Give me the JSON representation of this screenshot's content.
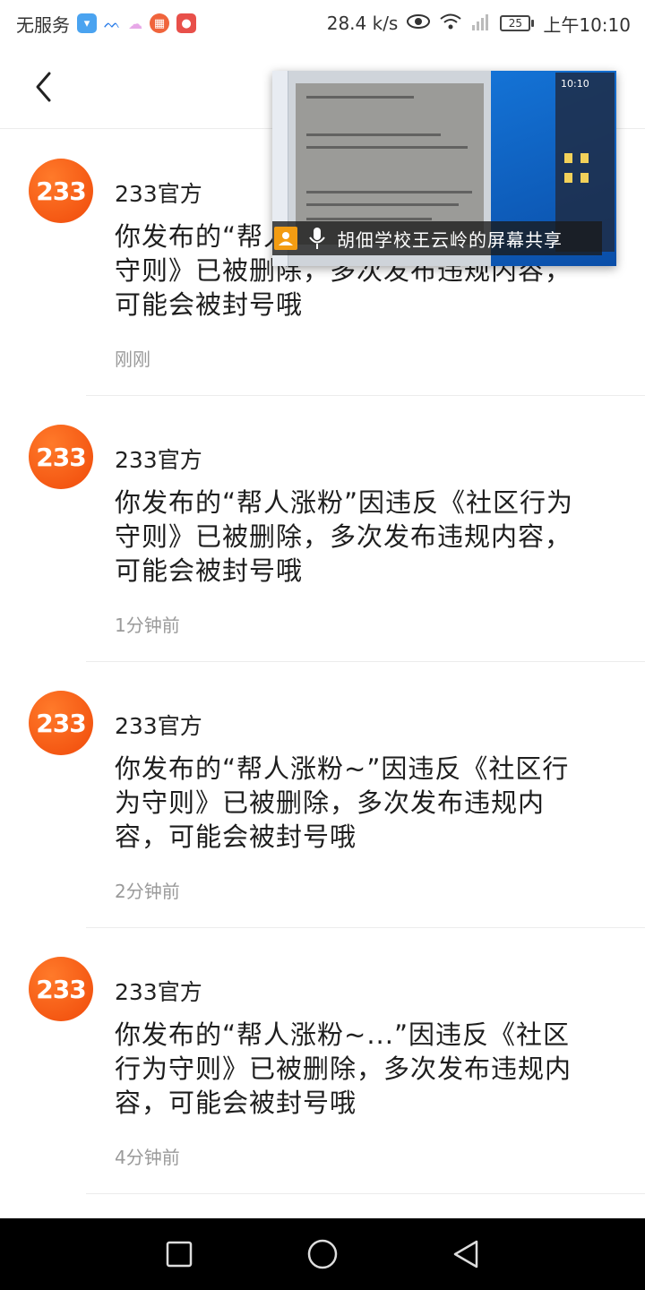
{
  "status_bar": {
    "carrier": "无服务",
    "net_speed": "28.4 k/s",
    "battery": "25",
    "time": "上午10:10",
    "icons": [
      "shield-app-icon",
      "bird-app-icon",
      "cloud-app-icon",
      "grid-app-icon",
      "mic-app-icon",
      "eye-icon",
      "wifi-icon",
      "signal-icon",
      "battery-icon"
    ]
  },
  "header": {
    "back_icon": "chevron-left-icon"
  },
  "screen_share": {
    "caption": "胡佃学校王云岭的屏幕共享",
    "clock": "10:10"
  },
  "messages": [
    {
      "avatar_text": "233",
      "sender": "233官方",
      "content": "你发布的“帮人涨粉”因违反《社区行为守则》已被删除，多次发布违规内容，可能会被封号哦",
      "time": "刚刚"
    },
    {
      "avatar_text": "233",
      "sender": "233官方",
      "content": "你发布的“帮人涨粉”因违反《社区行为守则》已被删除，多次发布违规内容，可能会被封号哦",
      "time": "1分钟前"
    },
    {
      "avatar_text": "233",
      "sender": "233官方",
      "content": "你发布的“帮人涨粉~”因违反《社区行为守则》已被删除，多次发布违规内容，可能会被封号哦",
      "time": "2分钟前"
    },
    {
      "avatar_text": "233",
      "sender": "233官方",
      "content": "你发布的“帮人涨粉~...”因违反《社区行为守则》已被删除，多次发布违规内容，可能会被封号哦",
      "time": "4分钟前"
    }
  ],
  "nav_bar": {
    "icons": [
      "recents-square-icon",
      "home-circle-icon",
      "back-triangle-icon"
    ]
  }
}
